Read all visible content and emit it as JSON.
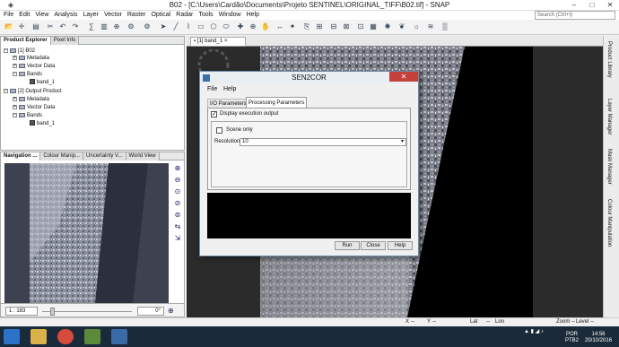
{
  "window": {
    "title": "B02 - [C:\\Users\\Cardão\\Documents\\Projeto SENTINEL\\ORIGINAL_TIFF\\B02.tif] - SNAP"
  },
  "menu": [
    "File",
    "Edit",
    "View",
    "Analysis",
    "Layer",
    "Vector",
    "Raster",
    "Optical",
    "Radar",
    "Tools",
    "Window",
    "Help"
  ],
  "search": {
    "placeholder": "Search (Ctrl+I)"
  },
  "explorer": {
    "tabs": [
      "Product Explorer",
      "Pixel Info"
    ],
    "product1": {
      "label": "[1] B02",
      "metadata": "Metadata",
      "vector": "Vector Data",
      "bands": "Bands",
      "band": "band_1"
    },
    "product2": {
      "label": "[2] Output Product",
      "metadata": "Metadata",
      "vector": "Vector Data",
      "bands": "Bands",
      "band": "band_1"
    }
  },
  "nav": {
    "tabs": [
      "Navigation ...",
      "Colour Manip...",
      "Uncertainty V...",
      "World View"
    ],
    "scale": "1 : 183",
    "rotation": "0°"
  },
  "view": {
    "tab": "[1] band_1"
  },
  "right_labels": [
    "Product Library",
    "Layer Manager",
    "Mask Manager",
    "Colour Manipulation"
  ],
  "status": {
    "x": "X",
    "y": "Y",
    "lat": "Lat",
    "lon": "Lon",
    "zoom": "Zoom --",
    "level": "Level --"
  },
  "dialog": {
    "title": "SEN2COR",
    "menu": [
      "File",
      "Help"
    ],
    "tabs": [
      "I/O Parameters",
      "Processing Parameters"
    ],
    "display_output": "Display execution output",
    "scene_only": "Scene only",
    "resolution_label": "Resolution:",
    "resolution_value": "10",
    "buttons": {
      "run": "Run",
      "close": "Close",
      "help": "Help"
    }
  },
  "taskbar": {
    "lang1": "POR",
    "lang2": "PTB2",
    "time": "14:56",
    "date": "20/10/2016"
  },
  "colors": {
    "accent": "#3c6ea8",
    "close_red": "#c4403a"
  }
}
